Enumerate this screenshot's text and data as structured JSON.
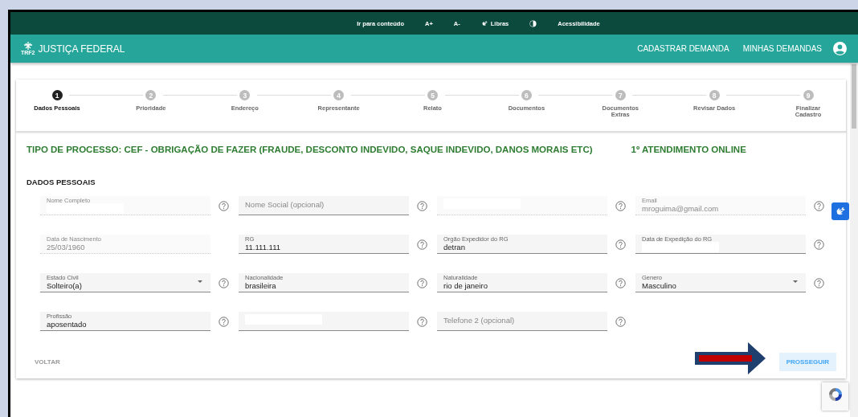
{
  "topbar": {
    "items": [
      {
        "kind": "text",
        "label": "Ir para conteúdo"
      },
      {
        "kind": "text",
        "label": "A+"
      },
      {
        "kind": "text",
        "label": "A-"
      },
      {
        "kind": "hands",
        "label": "Libras"
      },
      {
        "kind": "contrast"
      },
      {
        "kind": "text",
        "label": "Acessibilidade"
      }
    ]
  },
  "header": {
    "logo_text": "TRF2",
    "title": "JUSTIÇA FEDERAL",
    "nav": [
      "CADASTRAR DEMANDA",
      "MINHAS DEMANDAS"
    ]
  },
  "steps": [
    {
      "number": "1",
      "label": "Dados Pessoais",
      "selected": true
    },
    {
      "number": "2",
      "label": "Prioridade",
      "selected": false
    },
    {
      "number": "3",
      "label": "Endereço",
      "selected": false
    },
    {
      "number": "4",
      "label": "Representante",
      "selected": false
    },
    {
      "number": "5",
      "label": "Relato",
      "selected": false
    },
    {
      "number": "6",
      "label": "Documentos",
      "selected": false
    },
    {
      "number": "7",
      "label": "Documentos Extras",
      "selected": false
    },
    {
      "number": "8",
      "label": "Revisar Dados",
      "selected": false
    },
    {
      "number": "9",
      "label": "Finalizar Cadastro",
      "selected": false
    }
  ],
  "process_title": "TIPO DE PROCESSO: CEF - OBRIGAÇÃO DE FAZER (FRAUDE, DESCONTO INDEVIDO, SAQUE INDEVIDO, DANOS MORAIS ETC)",
  "service_title": "1º ATENDIMENTO ONLINE",
  "section_title": "DADOS PESSOAIS",
  "fields": [
    {
      "kind": "text",
      "label": "Nome Completo",
      "disabled": true,
      "redacted": true,
      "help": true
    },
    {
      "kind": "text",
      "placeholder": "Nome Social (opcional)",
      "disabled": false,
      "redacted": false,
      "help": true
    },
    {
      "kind": "text",
      "disabled": true,
      "redacted": true,
      "help": true
    },
    {
      "kind": "text",
      "label": "Email",
      "value": "mroguima@gmail.com",
      "disabled": true,
      "redacted": false,
      "help": true
    },
    {
      "kind": "text",
      "label": "Data de Nascimento",
      "value": "25/03/1960",
      "disabled": true,
      "redacted": false,
      "help": false
    },
    {
      "kind": "text",
      "label": "RG",
      "value": "11.111.111",
      "disabled": false,
      "redacted": false,
      "help": true
    },
    {
      "kind": "text",
      "label": "Orgão Expedidor do RG",
      "value": "detran",
      "disabled": false,
      "redacted": false,
      "help": true
    },
    {
      "kind": "text",
      "label": "Data de Expedição do RG",
      "disabled": false,
      "redacted": true,
      "help": true
    },
    {
      "kind": "select",
      "label": "Estado Civil",
      "value": "Solteiro(a)",
      "disabled": false,
      "redacted": false,
      "help": true
    },
    {
      "kind": "text",
      "label": "Nacionalidade",
      "value": "brasileira",
      "disabled": false,
      "redacted": false,
      "help": true
    },
    {
      "kind": "text",
      "label": "Naturalidade",
      "value": "rio de janeiro",
      "disabled": false,
      "redacted": false,
      "help": true
    },
    {
      "kind": "select",
      "label": "Genero",
      "value": "Masculino",
      "disabled": false,
      "redacted": false,
      "help": true
    },
    {
      "kind": "text",
      "label": "Profissão",
      "value": "aposentado",
      "disabled": false,
      "redacted": false,
      "help": true
    },
    {
      "kind": "text",
      "disabled": false,
      "redacted": true,
      "help": true
    },
    {
      "kind": "text",
      "placeholder": "Telefone 2 (opcional)",
      "disabled": false,
      "redacted": false,
      "help": true
    }
  ],
  "buttons": [
    {
      "label": "VOLTAR",
      "disabled": true
    },
    {
      "label": "PROSSEGUIR",
      "disabled": false
    }
  ]
}
